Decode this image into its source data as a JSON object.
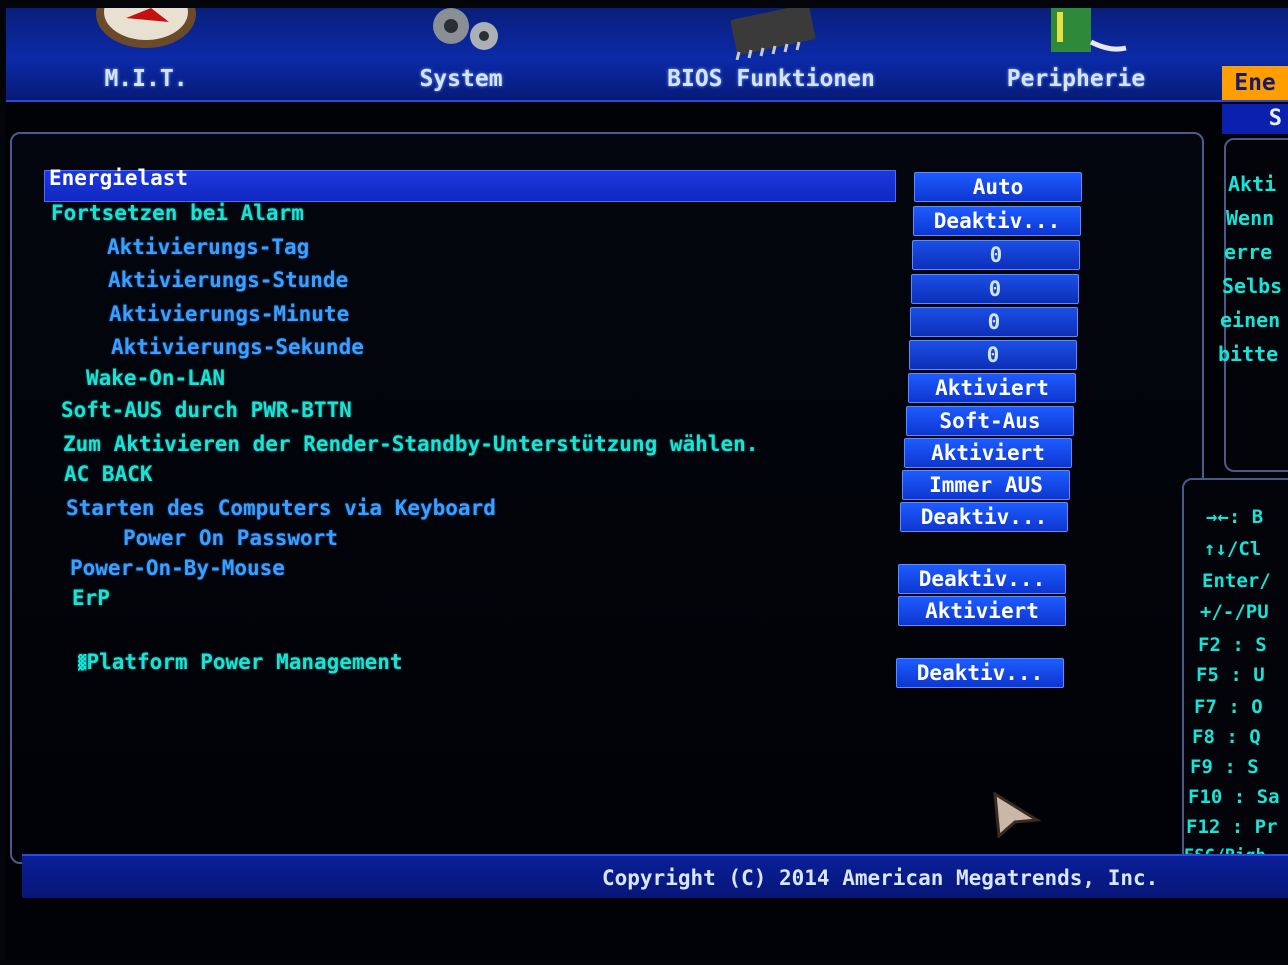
{
  "tabs": [
    {
      "label": "M.I.T.",
      "icon": "speedometer-icon"
    },
    {
      "label": "System",
      "icon": "gears-icon"
    },
    {
      "label": "BIOS Funktionen",
      "icon": "chip-icon"
    },
    {
      "label": "Peripherie",
      "icon": "card-icon"
    },
    {
      "label": "Ene",
      "active": true
    }
  ],
  "subtab": "S",
  "settings": [
    {
      "label": "Energielast",
      "value": "Auto"
    },
    {
      "label": "Fortsetzen bei Alarm",
      "value": "Deaktiv..."
    },
    {
      "label": "Aktivierungs-Tag",
      "value": "0"
    },
    {
      "label": "Aktivierungs-Stunde",
      "value": "0"
    },
    {
      "label": "Aktivierungs-Minute",
      "value": "0"
    },
    {
      "label": "Aktivierungs-Sekunde",
      "value": "0"
    },
    {
      "label": "Wake-On-LAN",
      "value": "Aktiviert"
    },
    {
      "label": "Soft-AUS durch PWR-BTTN",
      "value": "Soft-Aus"
    },
    {
      "label": "Zum Aktivieren der Render-Standby-Unterstützung wählen.",
      "value": "Aktiviert"
    },
    {
      "label": "AC BACK",
      "value": "Immer AUS"
    },
    {
      "label": "Starten des Computers via Keyboard",
      "value": "Deaktiv..."
    },
    {
      "label": "Power On Passwort"
    },
    {
      "label": "Power-On-By-Mouse",
      "value": "Deaktiv..."
    },
    {
      "label": "ErP",
      "value": "Aktiviert"
    },
    {
      "label": "Platform Power Management",
      "value": "Deaktiv..."
    }
  ],
  "help": [
    "Akti",
    "Wenn",
    "erre",
    "Selbs",
    "einen",
    "bitte"
  ],
  "keys": [
    "→←: B",
    "↑↓/Cl",
    "Enter/",
    "+/-/PU",
    "F2   : S",
    "F5   : U",
    "F7   : O",
    "F8   : Q",
    "F9   : S",
    "F10 : Sa",
    "F12 : Pr",
    "ESC/Righ"
  ],
  "footer": {
    "copyright": "Copyright (C) 2014 American Megatrends, Inc."
  },
  "colors": {
    "accent": "#1d38e0",
    "text": "#17e3d6",
    "sub_text": "#3aa0ff",
    "active_tab": "#ff9e00"
  }
}
